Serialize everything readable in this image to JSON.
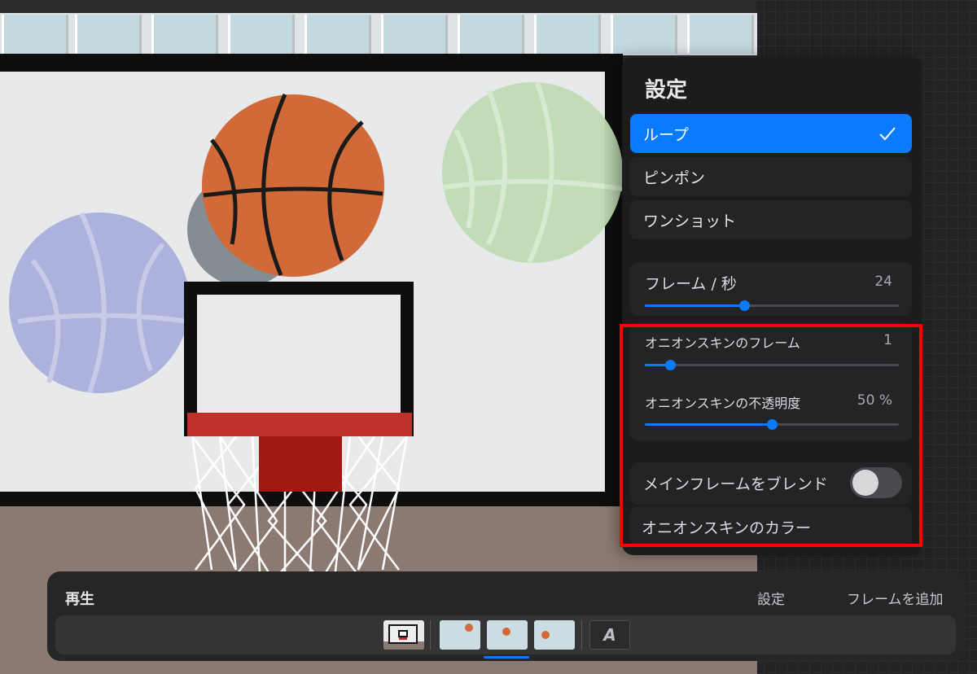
{
  "popover": {
    "title": "設定",
    "modes": [
      {
        "label": "ループ",
        "selected": true
      },
      {
        "label": "ピンポン",
        "selected": false
      },
      {
        "label": "ワンショット",
        "selected": false
      }
    ],
    "fps": {
      "label": "フレーム / 秒",
      "value": "24",
      "level": 0.39
    },
    "onion_frames": {
      "label": "オニオンスキンのフレーム",
      "value": "1",
      "level": 0.1
    },
    "onion_opacity": {
      "label": "オニオンスキンの不透明度",
      "value": "50 %",
      "level": 0.5
    },
    "blend": {
      "label": "メインフレームをブレンド",
      "on": false
    },
    "onion_color": {
      "label": "オニオンスキンのカラー"
    }
  },
  "timeline": {
    "title": "再生",
    "settings_label": "設定",
    "add_frame_label": "フレームを追加",
    "add_icon_glyph": "A"
  },
  "colors": {
    "accent": "#0a7aff",
    "highlight": "#ff0000",
    "ball_orange": "#d16a38",
    "ball_blue": "#a7addb",
    "ball_green": "#bfdcb4"
  }
}
